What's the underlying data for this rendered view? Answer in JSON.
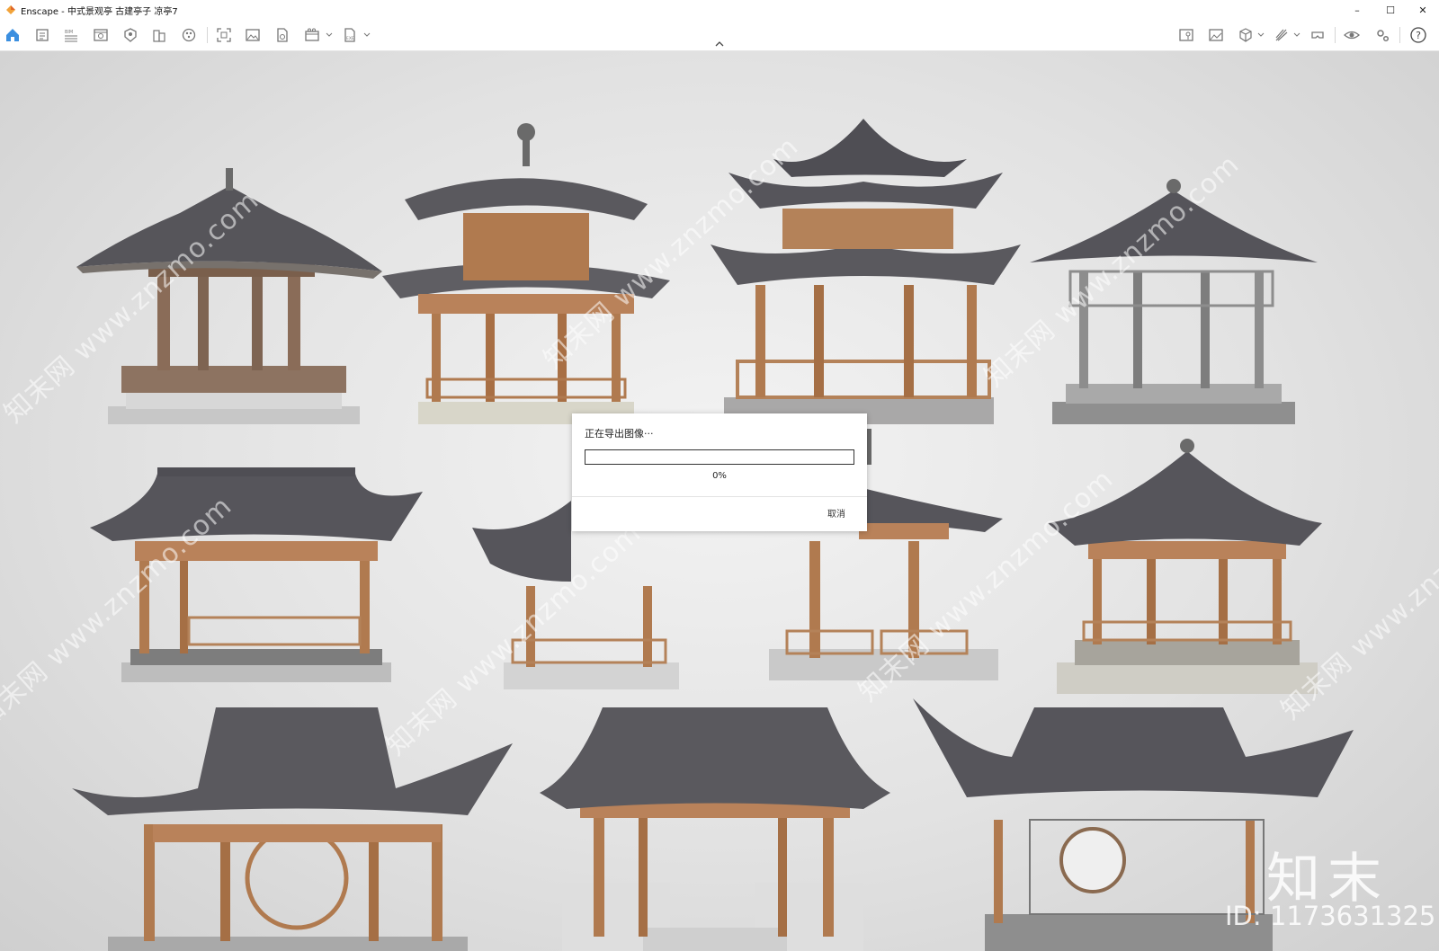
{
  "window": {
    "app_name": "Enscape",
    "title": "Enscape - 中式景观亭 古建亭子 凉亭7",
    "minimize_glyph": "–",
    "maximize_glyph": "☐",
    "close_glyph": "✕"
  },
  "toolbar": {
    "left_icons": [
      "home-icon",
      "settings-file-icon",
      "bim-icon",
      "view-icon",
      "asset-library-icon",
      "building-icon",
      "material-icon",
      "screenshot-icon",
      "image-export-icon",
      "batch-render-icon",
      "video-icon",
      "exe-export-icon"
    ],
    "right_icons": [
      "map-icon",
      "gallery-icon",
      "cube-icon",
      "sketch-icon",
      "vr-headset-icon",
      "visibility-icon",
      "settings-icon",
      "help-icon"
    ],
    "help_label": "?"
  },
  "dialog": {
    "title": "正在导出图像···",
    "progress_percent": 0,
    "progress_label": "0%",
    "cancel_label": "取消"
  },
  "watermark": {
    "site": "知末网 www.znzmo.com",
    "logo": "知末",
    "id": "ID: 1173631325"
  },
  "colors": {
    "accent": "#2a7ad8",
    "wood": "#b07a4f",
    "roof_tile": "#5c5c60",
    "stone": "#bdbdbd"
  }
}
